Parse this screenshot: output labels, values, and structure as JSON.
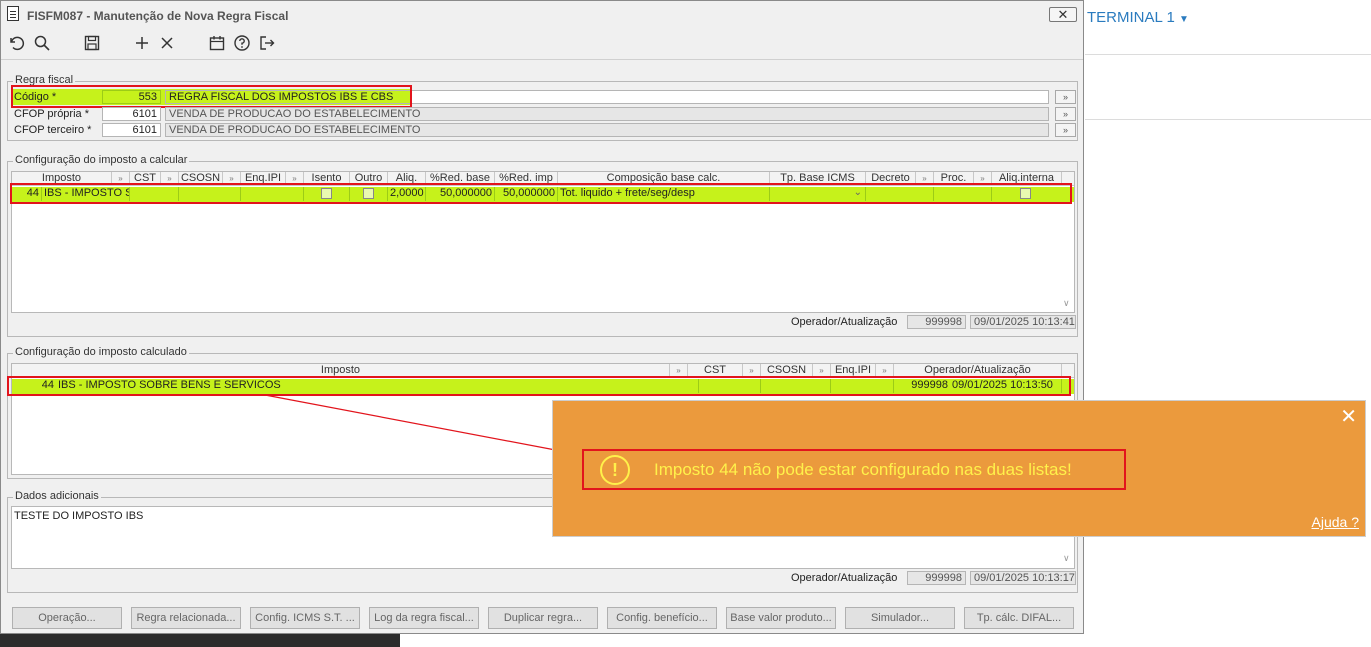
{
  "window": {
    "title": "FISFM087 - Manutenção de Nova Regra Fiscal"
  },
  "background_app": {
    "terminal_label": "TERMINAL 1"
  },
  "toolbar": {
    "icons": [
      "undo-icon",
      "search-icon",
      "save-icon",
      "add-icon",
      "delete-icon",
      "calendar-icon",
      "help-icon",
      "exit-icon"
    ]
  },
  "regra_fiscal": {
    "label": "Regra fiscal",
    "codigo_label": "Código *",
    "codigo_value": "553",
    "codigo_desc": "REGRA FISCAL DOS IMPOSTOS IBS E CBS",
    "cfop_propria_label": "CFOP própria *",
    "cfop_propria_value": "6101",
    "cfop_propria_desc": "VENDA DE PRODUCAO DO ESTABELECIMENTO",
    "cfop_terceiro_label": "CFOP terceiro *",
    "cfop_terceiro_value": "6101",
    "cfop_terceiro_desc": "VENDA DE PRODUCAO DO ESTABELECIMENTO"
  },
  "config_calcular": {
    "label": "Configuração do imposto a calcular",
    "columns": [
      "Imposto",
      "CST",
      "CSOSN",
      "Enq.IPI",
      "Isento",
      "Outro",
      "Aliq.",
      "%Red. base",
      "%Red. imp",
      "Composição base calc.",
      "Tp. Base ICMS",
      "Decreto",
      "Proc.",
      "Aliq.interna"
    ],
    "row": {
      "codigo": "44",
      "imposto": "IBS - IMPOSTO SC",
      "aliq": "2,0000",
      "red_base": "50,000000",
      "red_imp": "50,000000",
      "composicao": "Tot. liquido + frete/seg/desp"
    },
    "operador_label": "Operador/Atualização",
    "operador": "999998",
    "atualizacao": "09/01/2025 10:13:41"
  },
  "config_calculado": {
    "label": "Configuração do imposto calculado",
    "columns": [
      "Imposto",
      "CST",
      "CSOSN",
      "Enq.IPI",
      "Operador/Atualização"
    ],
    "row": {
      "codigo": "44",
      "imposto": "IBS - IMPOSTO SOBRE BENS E SERVICOS",
      "operador": "999998",
      "atualizacao": "09/01/2025 10:13:50"
    }
  },
  "dados_adicionais": {
    "label": "Dados adicionais",
    "text": "TESTE DO IMPOSTO IBS",
    "operador_label": "Operador/Atualização",
    "operador": "999998",
    "atualizacao": "09/01/2025 10:13:17"
  },
  "buttons": [
    "Operação...",
    "Regra relacionada...",
    "Config. ICMS S.T. ...",
    "Log da regra fiscal...",
    "Duplicar regra...",
    "Config. benefício...",
    "Base valor produto...",
    "Simulador...",
    "Tp. cálc. DIFAL..."
  ],
  "popup": {
    "message": "Imposto 44 não pode estar configurado nas duas listas!",
    "help": "Ajuda ?",
    "close": "✕",
    "icon_glyph": "!"
  },
  "colors": {
    "highlight": "#c6f21b",
    "popup_bg": "#eb9a3d",
    "annotation": "#e2141c",
    "message_text": "#fff14a"
  }
}
